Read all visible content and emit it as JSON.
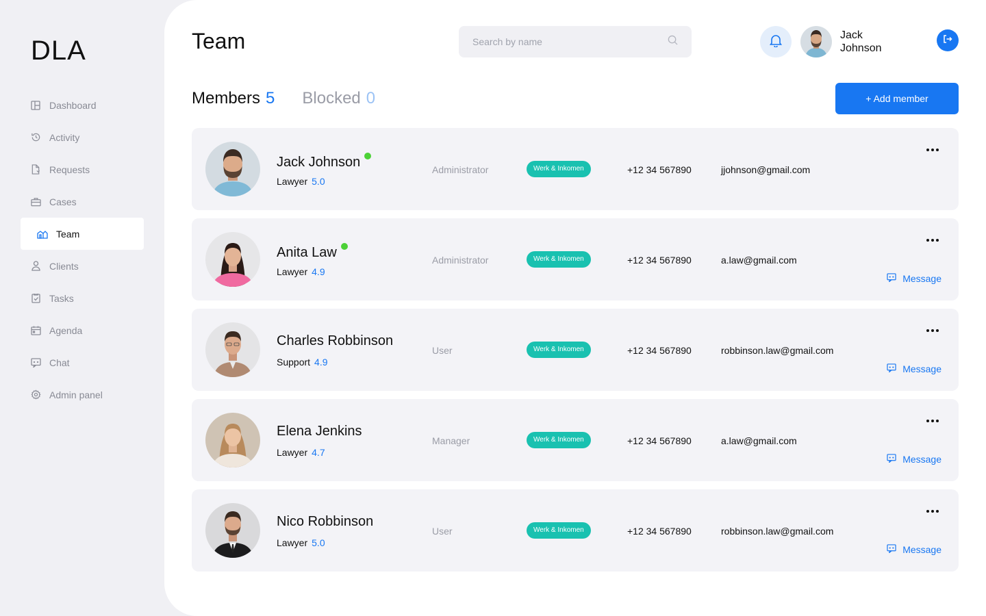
{
  "brand": {
    "logo_text": "DLA",
    "accent_color": "#1877f2",
    "tag_color": "#19c1b0",
    "online_color": "#4cd137"
  },
  "sidebar": {
    "items": [
      {
        "label": "Dashboard",
        "icon": "dashboard-icon",
        "active": false
      },
      {
        "label": "Activity",
        "icon": "history-icon",
        "active": false
      },
      {
        "label": "Requests",
        "icon": "document-icon",
        "active": false
      },
      {
        "label": "Cases",
        "icon": "briefcase-icon",
        "active": false
      },
      {
        "label": "Team",
        "icon": "team-icon",
        "active": true
      },
      {
        "label": "Clients",
        "icon": "user-icon",
        "active": false
      },
      {
        "label": "Tasks",
        "icon": "checklist-icon",
        "active": false
      },
      {
        "label": "Agenda",
        "icon": "calendar-icon",
        "active": false
      },
      {
        "label": "Chat",
        "icon": "chat-icon",
        "active": false
      },
      {
        "label": "Admin panel",
        "icon": "gear-icon",
        "active": false
      }
    ]
  },
  "header": {
    "title": "Team",
    "search_placeholder": "Search by name",
    "user_first_name": "Jack",
    "user_last_name": "Johnson"
  },
  "tabs": {
    "members_label": "Members",
    "members_count": "5",
    "blocked_label": "Blocked",
    "blocked_count": "0"
  },
  "add_member_label": "+ Add member",
  "members": [
    {
      "name": "Jack Johnson",
      "online": true,
      "title": "Lawyer",
      "rating": "5.0",
      "role": "Administrator",
      "tag": "Werk & Inkomen",
      "phone": "+12 34 567890",
      "email": "jjohnson@gmail.com",
      "message": ""
    },
    {
      "name": "Anita Law",
      "online": true,
      "title": "Lawyer",
      "rating": "4.9",
      "role": "Administrator",
      "tag": "Werk & Inkomen",
      "phone": "+12 34 567890",
      "email": "a.law@gmail.com",
      "message": "Message"
    },
    {
      "name": "Charles Robbinson",
      "online": false,
      "title": "Support",
      "rating": "4.9",
      "role": "User",
      "tag": "Werk & Inkomen",
      "phone": "+12 34 567890",
      "email": "robbinson.law@gmail.com",
      "message": "Message"
    },
    {
      "name": "Elena Jenkins",
      "online": false,
      "title": "Lawyer",
      "rating": "4.7",
      "role": "Manager",
      "tag": "Werk & Inkomen",
      "phone": "+12 34 567890",
      "email": "a.law@gmail.com",
      "message": "Message"
    },
    {
      "name": "Nico Robbinson",
      "online": false,
      "title": "Lawyer",
      "rating": "5.0",
      "role": "User",
      "tag": "Werk & Inkomen",
      "phone": "+12 34 567890",
      "email": "robbinson.law@gmail.com",
      "message": "Message"
    }
  ]
}
